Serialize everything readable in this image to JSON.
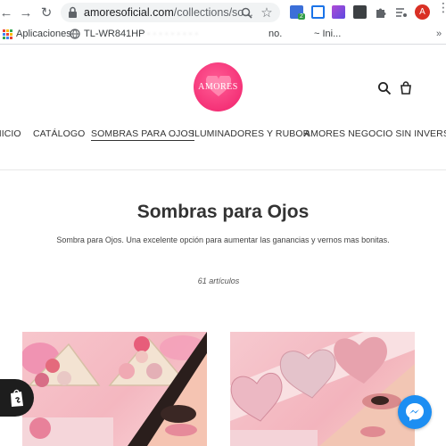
{
  "browser": {
    "url_host": "amoresoficial.com",
    "url_path": "/collections/so...",
    "avatar_letter": "A",
    "extension_badge": "2"
  },
  "bookmarks": {
    "apps_label": "Aplicaciones",
    "item1_label": "TL-WR841HP",
    "blurred_label": "· · · · · · · · · ·",
    "item2_label": "no.",
    "item3_label": "~ Ini..."
  },
  "store": {
    "logo_text": "AMORES",
    "brand_color": "#f0206b"
  },
  "nav": {
    "items": [
      {
        "label": "INICIO"
      },
      {
        "label": "CATÁLOGO"
      },
      {
        "label": "SOMBRAS PARA OJOS"
      },
      {
        "label": "ILUMINADORES Y RUBOR"
      },
      {
        "label": "AMORES NEGOCIO SIN INVERSIÓN"
      }
    ],
    "active_index": 2
  },
  "collection": {
    "title": "Sombras para Ojos",
    "description": "Sombra para Ojos. Una excelente opción para aumentar las ganancias y vernos mas bonitas.",
    "count": "61 artículos"
  },
  "products": [
    {
      "image": "triangle-eyeshadow-palette-photo"
    },
    {
      "image": "heart-highlighter-palette-photo"
    }
  ],
  "widgets": {
    "shop_icon": "shopify-bag-icon",
    "chat_icon": "messenger-icon",
    "chat_color": "#1c8ef2"
  }
}
